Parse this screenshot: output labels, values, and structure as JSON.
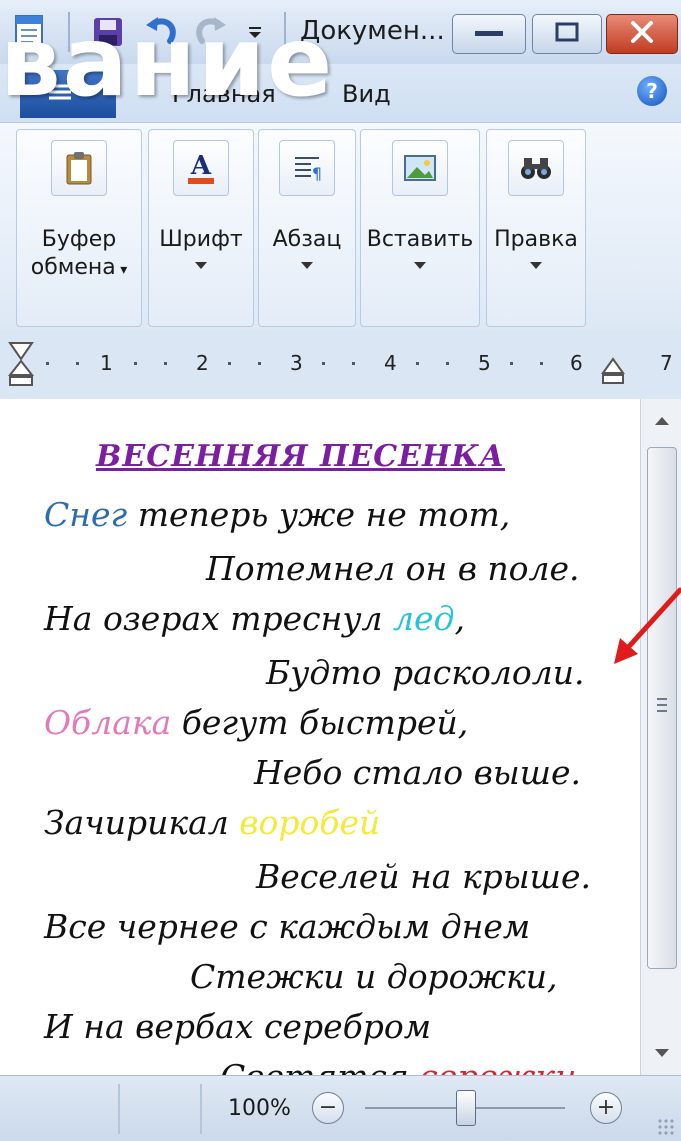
{
  "overlay_title": "вание",
  "titlebar": {
    "title": "Докумен...",
    "icons": [
      "wordpad-app-icon",
      "save-icon",
      "undo-icon",
      "redo-icon",
      "customize-qat-icon"
    ],
    "buttons": [
      "minimize-icon",
      "maximize-icon",
      "close-icon"
    ]
  },
  "tabs": {
    "file_icon": "file-menu-icon",
    "home": "Главная",
    "view": "Вид",
    "help_icon": "?"
  },
  "ribbon": {
    "groups": [
      {
        "label_line1": "Буфер",
        "label_line2": "обмена",
        "icon": "clipboard-icon"
      },
      {
        "label_line1": "Шрифт",
        "label_line2": "",
        "icon": "font-color-icon"
      },
      {
        "label_line1": "Абзац",
        "label_line2": "",
        "icon": "paragraph-icon"
      },
      {
        "label_line1": "Вставить",
        "label_line2": "",
        "icon": "picture-icon"
      },
      {
        "label_line1": "Правка",
        "label_line2": "",
        "icon": "find-binoculars-icon"
      }
    ]
  },
  "ruler": {
    "numbers": [
      "1",
      "2",
      "3",
      "4",
      "5",
      "6",
      "7"
    ]
  },
  "document": {
    "title": "ВЕСЕННЯЯ ПЕСЕНКА",
    "lines": [
      {
        "pre": "",
        "hl": "Снег",
        "post": " теперь уже не тот,"
      },
      {
        "pre": "Потемнел он в поле.",
        "hl": "",
        "post": ""
      },
      {
        "pre": "На озерах треснул ",
        "hl": "лед",
        "post": ","
      },
      {
        "pre": "Будто раскололи.",
        "hl": "",
        "post": ""
      },
      {
        "pre": "",
        "hl": "Облака",
        "post": " бегут быстрей,"
      },
      {
        "pre": "Небо стало выше.",
        "hl": "",
        "post": ""
      },
      {
        "pre": "Зачирикал ",
        "hl": "воробей",
        "post": ""
      },
      {
        "pre": "Веселей на крыше.",
        "hl": "",
        "post": ""
      },
      {
        "pre": "Все чернее с каждым днем",
        "hl": "",
        "post": ""
      },
      {
        "pre": "Стежки и дорожки,",
        "hl": "",
        "post": ""
      },
      {
        "pre": "И на вербах серебром",
        "hl": "",
        "post": ""
      },
      {
        "pre": "Светятся ",
        "hl": "сережки",
        "post": "."
      }
    ],
    "highlight_colors": {
      "snow": "#2b6cb0",
      "ice": "#22c5d8",
      "clouds": "#e27ab8",
      "sparrow": "#f4ea3a",
      "catkins": "#d8232a",
      "title": "#7b1fa2"
    }
  },
  "statusbar": {
    "zoom": "100%",
    "zoom_out": "−",
    "zoom_in": "+",
    "zoom_level_fraction": 0.5
  },
  "annotation": {
    "arrow_color": "#e01b1b"
  }
}
